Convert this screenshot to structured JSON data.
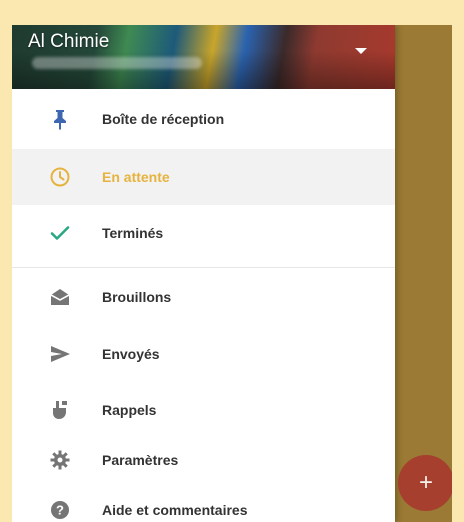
{
  "account": {
    "name": "Al Chimie",
    "email_blurred": true
  },
  "menu": {
    "primary": [
      {
        "label": "Boîte de réception",
        "icon": "pin-icon",
        "active": false
      },
      {
        "label": "En attente",
        "icon": "clock-icon",
        "active": true
      },
      {
        "label": "Terminés",
        "icon": "check-icon",
        "active": false
      }
    ],
    "secondary": [
      {
        "label": "Brouillons",
        "icon": "drafts-icon"
      },
      {
        "label": "Envoyés",
        "icon": "send-icon"
      },
      {
        "label": "Rappels",
        "icon": "reminder-icon"
      },
      {
        "label": "Paramètres",
        "icon": "gear-icon"
      },
      {
        "label": "Aide et commentaires",
        "icon": "help-icon"
      }
    ]
  },
  "fab": {
    "symbol": "+"
  },
  "colors": {
    "accent_yellow": "#e6b33f",
    "check_green": "#2aa884",
    "pin_blue": "#3d67b1",
    "fab_red": "#a8392d",
    "page_background": "#fbe7b0",
    "scrim": "#9a7a34"
  }
}
